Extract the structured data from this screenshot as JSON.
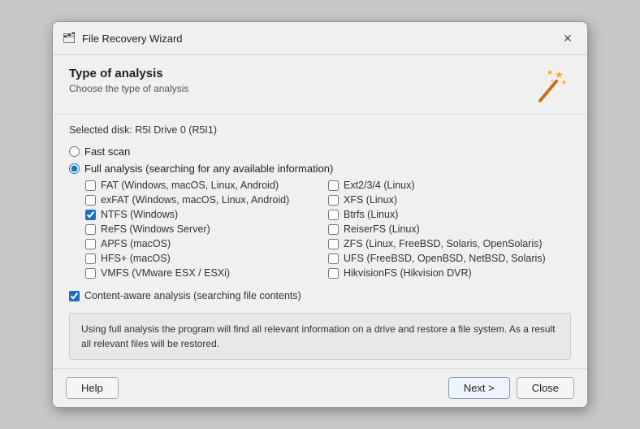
{
  "titleBar": {
    "icon": "🗂",
    "title": "File Recovery Wizard",
    "closeLabel": "✕"
  },
  "header": {
    "heading": "Type of analysis",
    "subtext": "Choose the type of analysis"
  },
  "selectedDisk": "Selected disk: R5I Drive 0 (R5I1)",
  "analysisOptions": {
    "fastScan": {
      "label": "Fast scan",
      "checked": false
    },
    "fullAnalysis": {
      "label": "Full analysis (searching for any available information)",
      "checked": true
    }
  },
  "filesystems": {
    "left": [
      {
        "id": "fat",
        "label": "FAT (Windows, macOS, Linux, Android)",
        "checked": false
      },
      {
        "id": "exfat",
        "label": "exFAT (Windows, macOS, Linux, Android)",
        "checked": false
      },
      {
        "id": "ntfs",
        "label": "NTFS (Windows)",
        "checked": true
      },
      {
        "id": "refs",
        "label": "ReFS (Windows Server)",
        "checked": false
      },
      {
        "id": "apfs",
        "label": "APFS (macOS)",
        "checked": false
      },
      {
        "id": "hfsplus",
        "label": "HFS+ (macOS)",
        "checked": false
      },
      {
        "id": "vmfs",
        "label": "VMFS (VMware ESX / ESXi)",
        "checked": false
      }
    ],
    "right": [
      {
        "id": "ext234",
        "label": "Ext2/3/4 (Linux)",
        "checked": false
      },
      {
        "id": "xfs",
        "label": "XFS (Linux)",
        "checked": false
      },
      {
        "id": "btrfs",
        "label": "Btrfs (Linux)",
        "checked": false
      },
      {
        "id": "reiserfs",
        "label": "ReiserFS (Linux)",
        "checked": false
      },
      {
        "id": "zfs",
        "label": "ZFS (Linux, FreeBSD, Solaris, OpenSolaris)",
        "checked": false
      },
      {
        "id": "ufs",
        "label": "UFS (FreeBSD, OpenBSD, NetBSD, Solaris)",
        "checked": false
      },
      {
        "id": "hikvision",
        "label": "HikvisionFS (Hikvision DVR)",
        "checked": false
      }
    ]
  },
  "contentAware": {
    "label": "Content-aware analysis (searching file contents)",
    "checked": true
  },
  "description": "Using full analysis the program will find all relevant information on a drive and restore a file system. As a result all relevant files will be restored.",
  "footer": {
    "helpLabel": "Help",
    "nextLabel": "Next >",
    "closeLabel": "Close"
  }
}
